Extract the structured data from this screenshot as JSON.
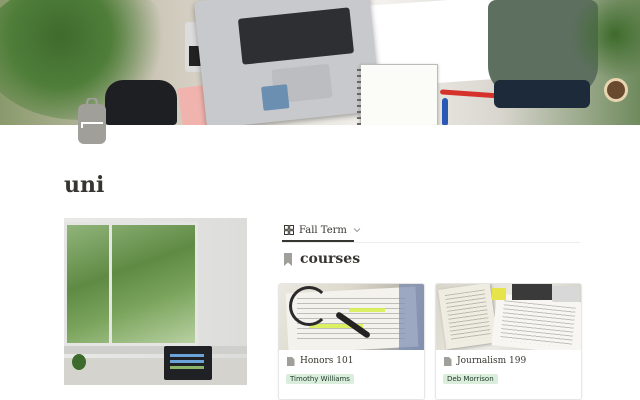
{
  "page": {
    "title": "uni",
    "icon": "backpack-icon"
  },
  "view": {
    "label": "Fall Term",
    "icon": "gallery-grid-icon"
  },
  "section": {
    "heading": "courses",
    "icon": "bookmark-icon"
  },
  "cards": [
    {
      "title": "Honors 101",
      "tag": "Timothy Williams",
      "icon": "page-icon"
    },
    {
      "title": "Journalism 199",
      "tag": "Deb Morrison",
      "icon": "page-icon"
    }
  ],
  "colors": {
    "text": "#37352f",
    "tag_bg": "#dbeddb",
    "tag_text": "#1c3829",
    "icon_grey": "#a19f9a"
  }
}
